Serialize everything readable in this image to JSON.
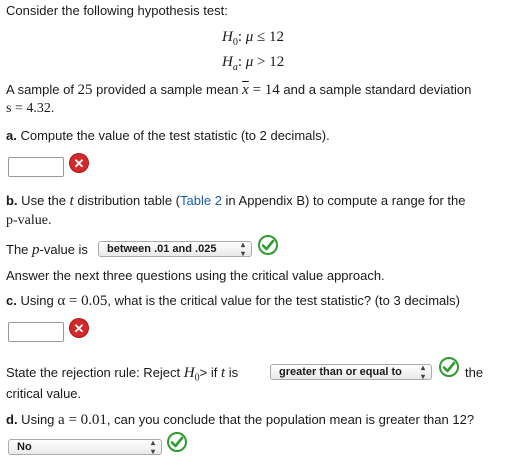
{
  "intro": "Consider the following hypothesis test:",
  "hypotheses": {
    "h0": "≤ 12",
    "ha": "> 12"
  },
  "sample_text": {
    "part1": "A sample of ",
    "n": "25",
    "part2": " provided a sample mean ",
    "part3": " = 14",
    "part4": " and a sample standard deviation",
    "s_value": "s = 4.32."
  },
  "question_a": {
    "label": "a.",
    "text": " Compute the value of the test statistic (to 2 decimals)."
  },
  "question_b": {
    "label": "b.",
    "text1": " Use the ",
    "t": "t",
    "text2": " distribution table (",
    "link": "Table 2",
    "text3": " in Appendix B) to compute a range for the",
    "line2": "p-value.",
    "pvalue_label_pre": "The ",
    "pvalue_label_p": "p",
    "pvalue_label_post": "-value is",
    "pvalue_select": "between .01 and .025"
  },
  "critical_intro": "Answer the next three questions using the critical value approach.",
  "question_c": {
    "label": "c.",
    "text1": " Using ",
    "alpha": "α = 0.05",
    "text2": ", what is the critical value for the test statistic? (to 3 decimals)"
  },
  "rejection_rule": {
    "text1": "State the rejection rule: Reject ",
    "h0": "H",
    "text2": "> if ",
    "t": "t",
    "text3": " is",
    "select": "greater than or equal to",
    "text4": "the",
    "line2": "critical value."
  },
  "question_d": {
    "label": "d.",
    "text1": " Using ",
    "alpha": "a = 0.01",
    "text2": ", can you conclude that the population mean is greater than 12?",
    "select": "No"
  },
  "colors": {
    "wrong": "#d22a2a",
    "correct": "#2e9c2e",
    "link": "#1a5db3"
  },
  "icons": {
    "wrong": "x-icon",
    "correct": "checkmark-icon",
    "select": "chevron-updown-icon"
  }
}
